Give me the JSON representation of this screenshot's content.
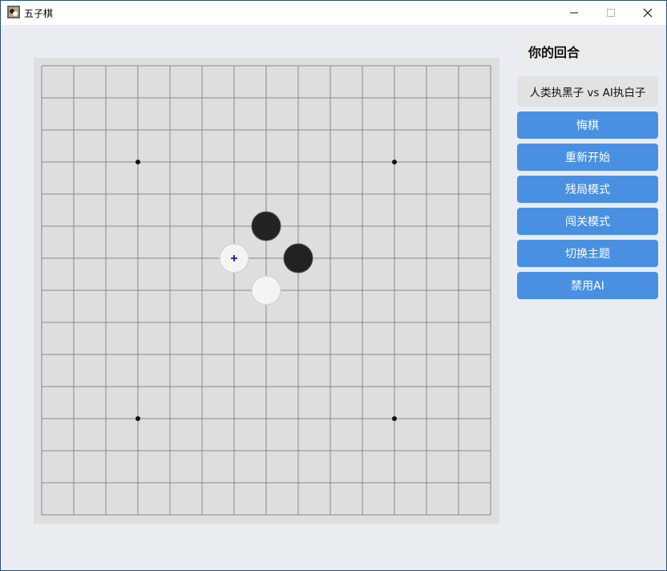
{
  "window": {
    "title": "五子棋"
  },
  "panel": {
    "turn_label": "你的回合",
    "mode_label": "人类执黑子 vs AI执白子",
    "buttons": [
      "悔棋",
      "重新开始",
      "残局模式",
      "闯关模式",
      "切换主题",
      "禁用AI"
    ]
  },
  "board": {
    "size": 15,
    "star_points": [
      [
        3,
        3
      ],
      [
        3,
        11
      ],
      [
        11,
        3
      ],
      [
        11,
        11
      ]
    ],
    "stones": [
      {
        "color": "black",
        "col": 7,
        "row": 5
      },
      {
        "color": "black",
        "col": 8,
        "row": 6
      },
      {
        "color": "white",
        "col": 6,
        "row": 6,
        "last_move": true
      },
      {
        "color": "white",
        "col": 7,
        "row": 7
      }
    ]
  },
  "colors": {
    "accent": "#4a90e2",
    "board": "#dedede",
    "grid_line": "#8a8a8a",
    "black_stone": "#222222",
    "white_stone": "#f4f4f4",
    "last_move_marker": "#1a1aa8"
  },
  "icons": {
    "app": "gomoku-app-icon",
    "minimize": "minimize-icon",
    "maximize": "maximize-icon",
    "close": "close-icon"
  }
}
